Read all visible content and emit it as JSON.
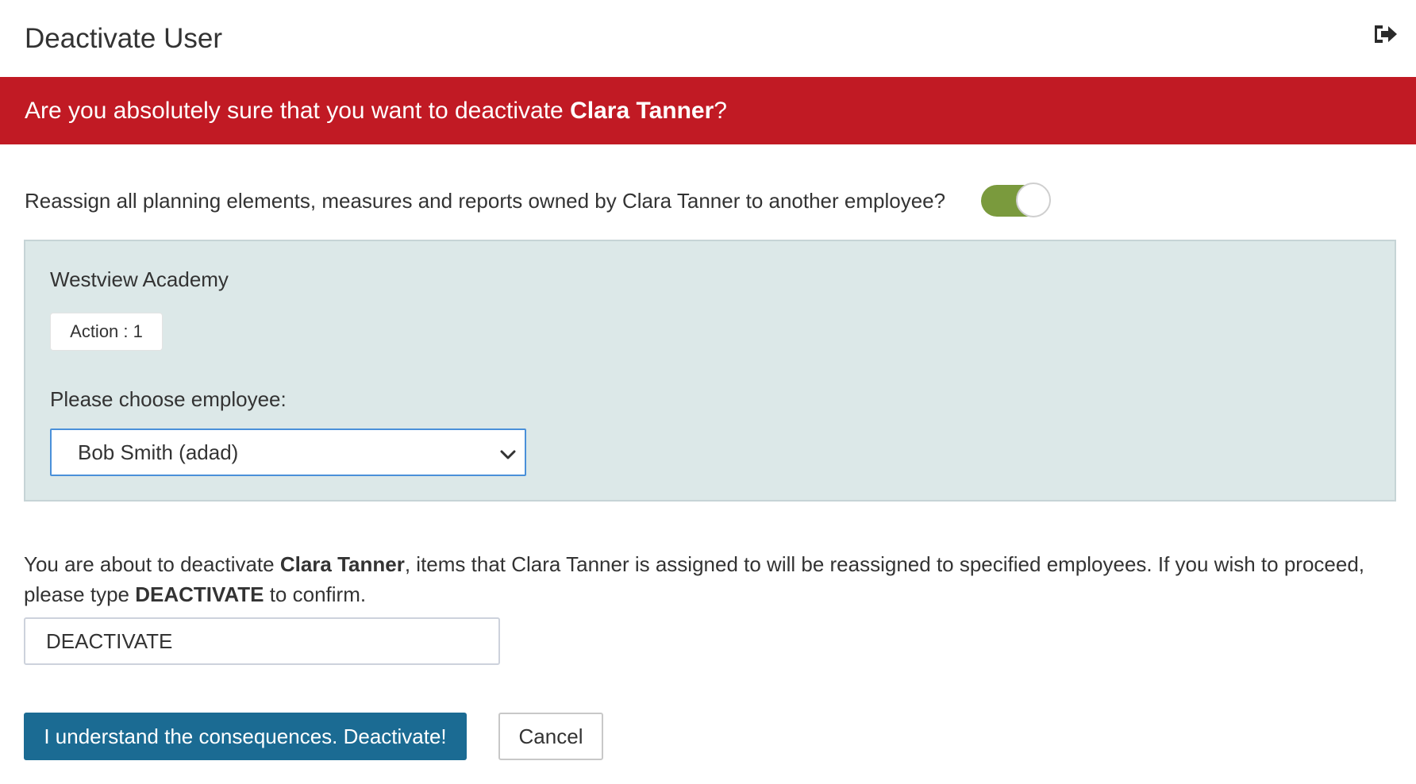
{
  "header": {
    "title": "Deactivate User",
    "exit_icon": "sign-out-icon"
  },
  "banner": {
    "prefix": "Are you absolutely sure that you want to deactivate ",
    "user_name": "Clara Tanner",
    "suffix": "?",
    "color": "#c11a24"
  },
  "reassign": {
    "question": "Reassign all planning elements, measures and reports owned by Clara Tanner to another employee?",
    "toggle_on": true,
    "toggle_color": "#7a9a3d"
  },
  "panel": {
    "school": "Westview Academy",
    "badge": "Action : 1",
    "choose_label": "Please choose employee:",
    "selected_employee": "Bob Smith (adad)"
  },
  "confirm": {
    "text_1": "You are about to deactivate ",
    "user_name": "Clara Tanner",
    "text_2": ", items that Clara Tanner is assigned to will be reassigned to specified employees. If you wish to proceed, please type ",
    "keyword": "DEACTIVATE",
    "text_3": " to confirm.",
    "input_value": "DEACTIVATE"
  },
  "buttons": {
    "deactivate": "I understand the consequences. Deactivate!",
    "cancel": "Cancel",
    "primary_color": "#1b6b93"
  }
}
